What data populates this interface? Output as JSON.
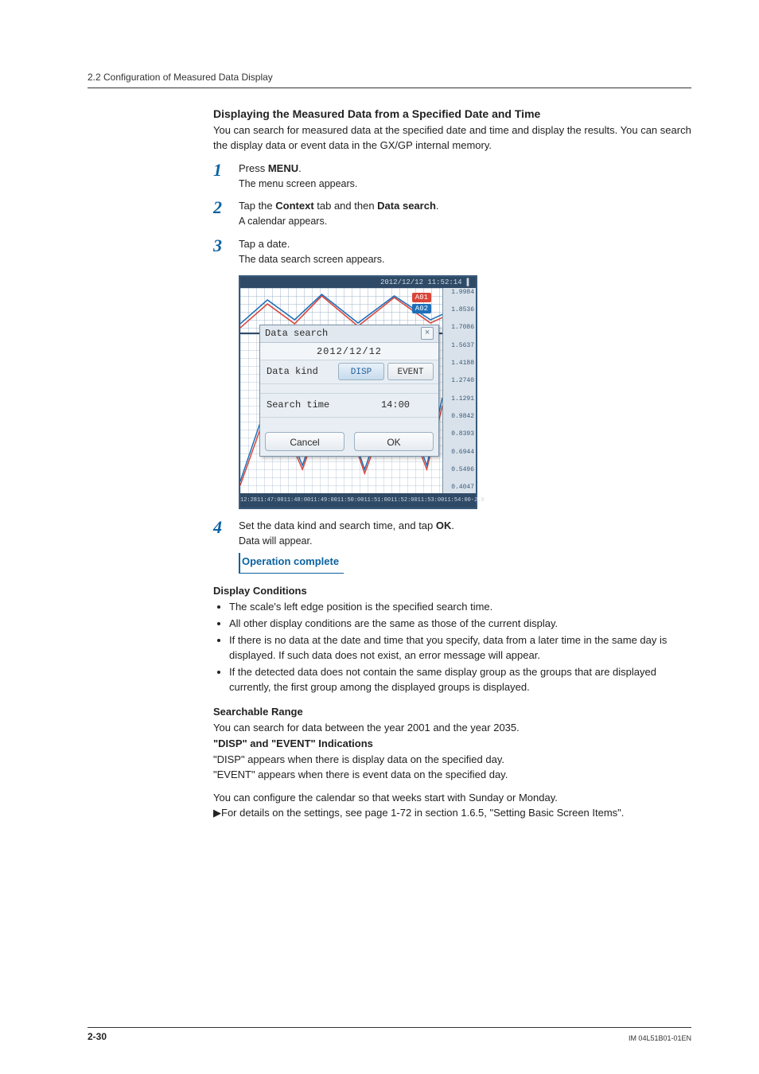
{
  "section_header": "2.2  Configuration of Measured Data Display",
  "title": "Displaying the Measured Data from a Specified Date and Time",
  "intro": "You can search for measured data at the specified date and time and display the results. You can search the display data or event data in the GX/GP internal memory.",
  "steps": [
    {
      "num": "1",
      "line": "Press <b>MENU</b>.",
      "sub": "The menu screen appears."
    },
    {
      "num": "2",
      "line": "Tap the <b>Context</b> tab and then <b>Data search</b>.",
      "sub": "A calendar appears."
    },
    {
      "num": "3",
      "line": "Tap a date.",
      "sub": "The data search screen appears."
    },
    {
      "num": "4",
      "line": "Set the data kind and search time, and tap <b>OK</b>.",
      "sub": "Data will appear."
    }
  ],
  "op_complete": "Operation complete",
  "display_conditions": {
    "heading": "Display Conditions",
    "items": [
      "The scale's left edge position is the specified search time.",
      "All other display conditions are the same as those of the current display.",
      "If there is no data at the date and time that you specify, data from a later time in the same day is displayed. If such data does not exist, an error message will appear.",
      "If the detected data does not contain the same display group as the groups that are displayed currently, the first group among the displayed groups is displayed."
    ]
  },
  "searchable_range": {
    "heading": "Searchable Range",
    "text": "You can search for data between the year 2001 and the year 2035.",
    "sub_heading": "\"DISP\" and \"EVENT\" Indications",
    "disp_text": "\"DISP\" appears when there is display data on the specified day.",
    "event_text": "\"EVENT\" appears when there is event data on the specified day.",
    "cal_text": "You can configure the calendar so that weeks start with Sunday or Monday.",
    "xref": "For details on the settings, see page 1-72 in section 1.6.5, \"Setting Basic Screen Items\"."
  },
  "figure": {
    "timestamp": "2012/12/12 11:52:14",
    "panel_title": "Data search",
    "date": "2012/12/12",
    "data_kind_label": "Data kind",
    "disp_btn": "DISP",
    "event_btn": "EVENT",
    "search_time_label": "Search time",
    "search_time_value": "14:00",
    "cancel": "Cancel",
    "ok": "OK",
    "tagA": "A01",
    "tagB": "A02",
    "scale": [
      "1.9984",
      "1.8536",
      "1.7086",
      "1.5637",
      "1.4188",
      "1.2740",
      "1.1291",
      "0.9842",
      "0.8393",
      "0.6944",
      "0.5496",
      "0.4047"
    ],
    "time_ticks": [
      "12:28",
      "11:47:00",
      "11:48:00",
      "11:49:00",
      "11:50:00",
      "11:51:00",
      "11:52:00",
      "11:53:00",
      "11:54:00",
      "-2.0"
    ]
  },
  "footer": {
    "page": "2-30",
    "doc": "IM 04L51B01-01EN"
  }
}
